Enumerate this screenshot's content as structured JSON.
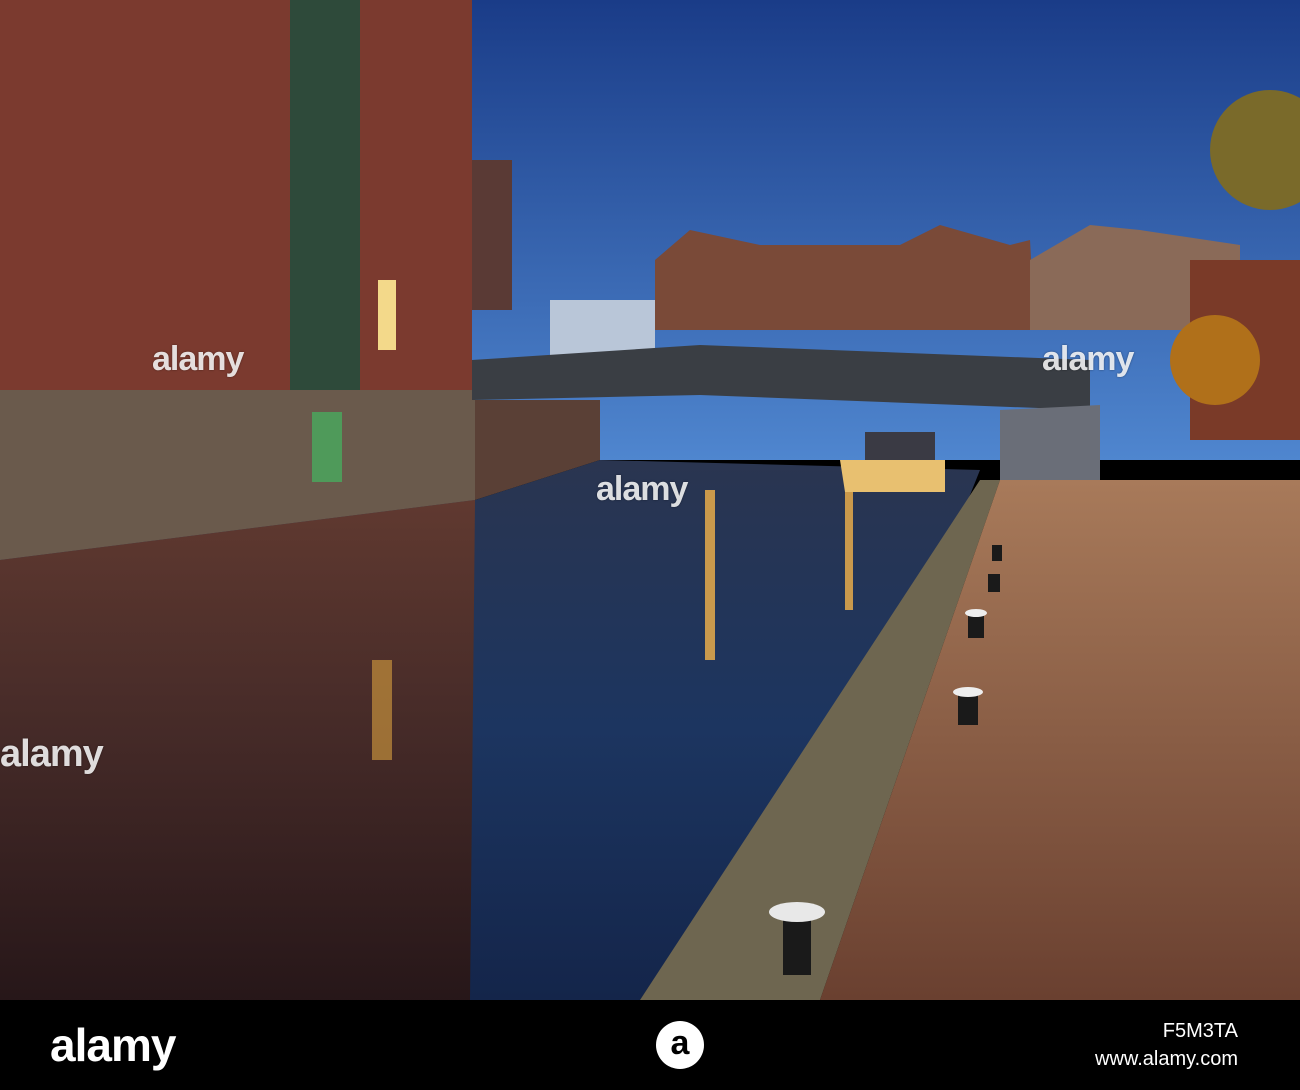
{
  "photo": {
    "subject": "canal-at-dusk"
  },
  "watermarks": [
    "alamy",
    "alamy",
    "alamy",
    "alamy"
  ],
  "footer": {
    "logo": "alamy",
    "badge": "a",
    "image_id": "F5M3TA",
    "url": "www.alamy.com"
  },
  "colors": {
    "sky_top": "#1a3f8c",
    "sky_bottom": "#4a7fc9",
    "brick": "#7b3a2f",
    "water": "#1a2a4a",
    "path": "#8a5a3e"
  }
}
